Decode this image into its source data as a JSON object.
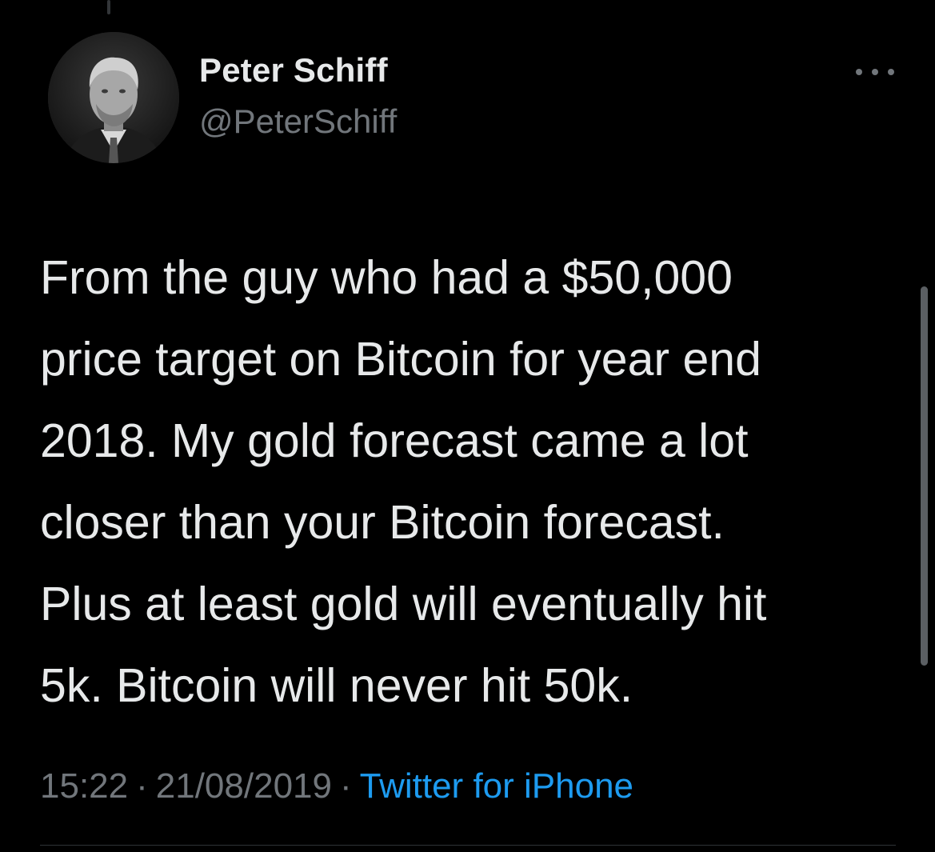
{
  "tweet": {
    "author": {
      "display_name": "Peter Schiff",
      "handle": "@PeterSchiff"
    },
    "text": "From the guy who had a $50,000\nprice target on Bitcoin for year end\n2018.  My gold forecast came a lot\ncloser than your Bitcoin forecast.\nPlus at least gold will eventually hit\n5k.  Bitcoin will never hit 50k.",
    "time": "15:22",
    "date": "21/08/2019",
    "separator": "·",
    "source": "Twitter for iPhone"
  },
  "icons": {
    "more": "more-horizontal-icon",
    "avatar": "avatar-photo"
  },
  "colors": {
    "background": "#000000",
    "primary_text": "#e7e9ea",
    "secondary_text": "#71767b",
    "link": "#1d9bf0"
  }
}
